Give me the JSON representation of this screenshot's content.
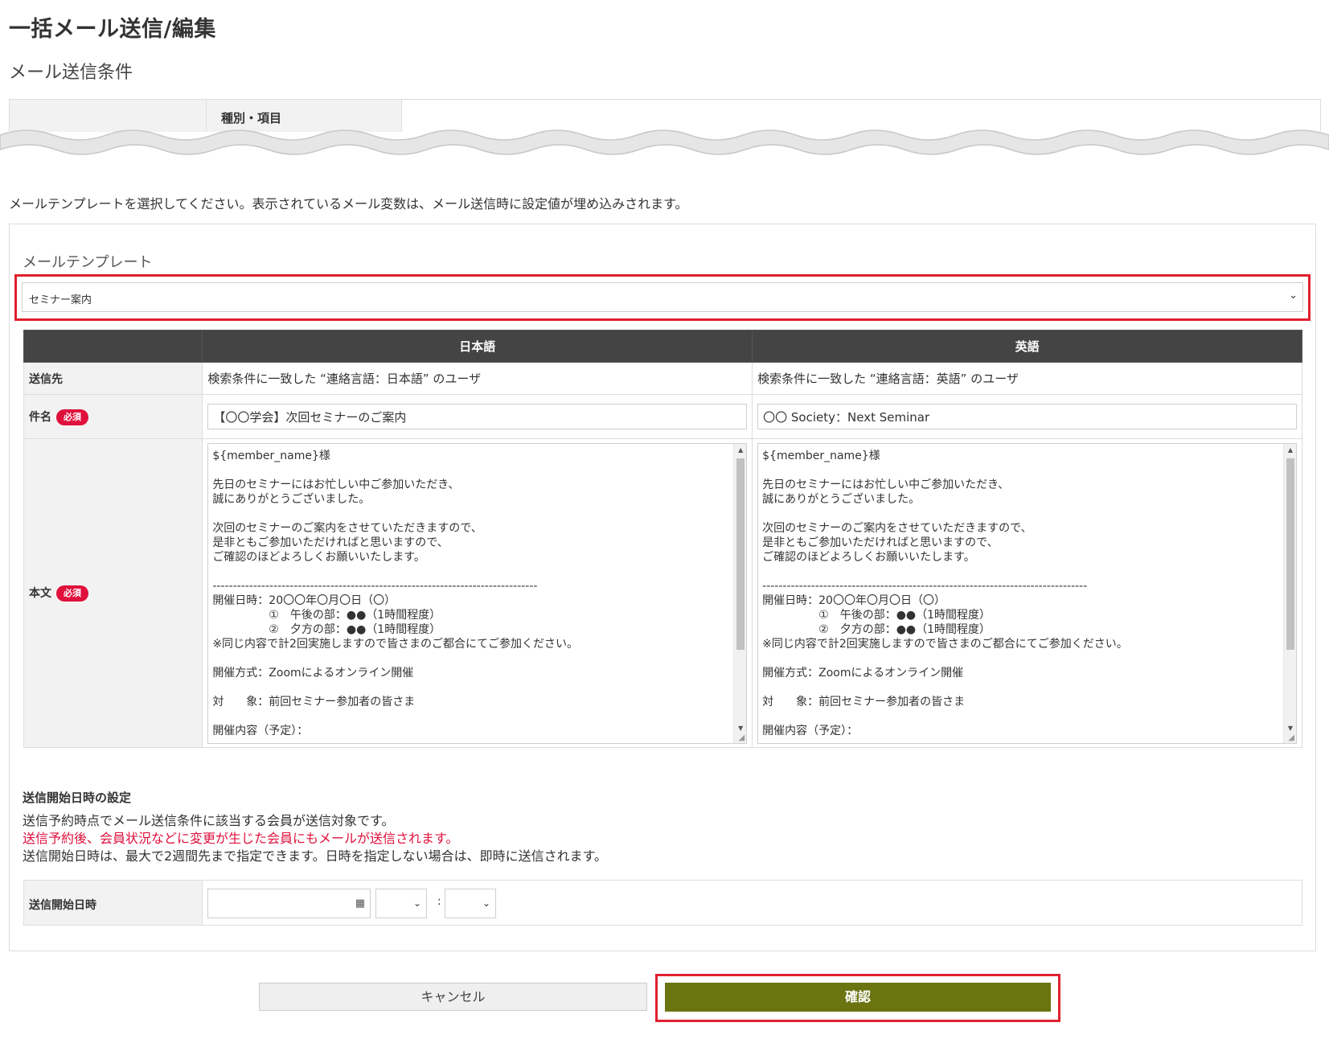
{
  "page": {
    "title": "一括メール送信/編集",
    "conditions_title": "メール送信条件",
    "conditions_header": "種別・項目",
    "instruction": "メールテンプレートを選択してください。表示されているメール変数は、メール送信時に設定値が埋め込みされます。"
  },
  "template": {
    "label": "メールテンプレート",
    "selected": "セミナー案内"
  },
  "table": {
    "col_ja": "日本語",
    "col_en": "英語",
    "row_recipient": "送信先",
    "row_subject": "件名",
    "row_body": "本文",
    "required_badge": "必須",
    "recipient_ja": "検索条件に一致した “連絡言語：日本語” のユーザ",
    "recipient_en": "検索条件に一致した “連絡言語：英語” のユーザ",
    "subject_ja": "【〇〇学会】次回セミナーのご案内",
    "subject_en": "〇〇 Society：Next Seminar",
    "body_ja": "${member_name}様\n\n先日のセミナーにはお忙しい中ご参加いただき、\n誠にありがとうございました。\n\n次回のセミナーのご案内をさせていただきますので、\n是非ともご参加いただければと思いますので、\nご確認のほどよろしくお願いいたします。\n\n--------------------------------------------------------------------------------\n開催日時：20〇〇年〇月〇日（〇）\n　　　　　①　午後の部：●●（1時間程度）\n　　　　　②　夕方の部：●●（1時間程度）\n※同じ内容で計2回実施しますので皆さまのご都合にてご参加ください。\n\n開催方式：Zoomによるオンライン開催\n\n対　　象：前回セミナー参加者の皆さま\n\n開催内容（予定）：",
    "body_en": "${member_name}様\n\n先日のセミナーにはお忙しい中ご参加いただき、\n誠にありがとうございました。\n\n次回のセミナーのご案内をさせていただきますので、\n是非ともご参加いただければと思いますので、\nご確認のほどよろしくお願いいたします。\n\n--------------------------------------------------------------------------------\n開催日時：20〇〇年〇月〇日（〇）\n　　　　　①　午後の部：●●（1時間程度）\n　　　　　②　夕方の部：●●（1時間程度）\n※同じ内容で計2回実施しますので皆さまのご都合にてご参加ください。\n\n開催方式：Zoomによるオンライン開催\n\n対　　象：前回セミナー参加者の皆さま\n\n開催内容（予定）："
  },
  "schedule": {
    "title": "送信開始日時の設定",
    "line1": "送信予約時点でメール送信条件に該当する会員が送信対象です。",
    "line2_warning": "送信予約後、会員状況などに変更が生じた会員にもメールが送信されます。",
    "line3": "送信開始日時は、最大で2週間先まで指定できます。日時を指定しない場合は、即時に送信されます。",
    "field_label": "送信開始日時",
    "date_value": "",
    "hour_value": "",
    "minute_value": "",
    "separator": ":"
  },
  "buttons": {
    "cancel": "キャンセル",
    "confirm": "確認"
  },
  "colors": {
    "accent_red": "#e0202e",
    "confirm_button": "#6b7410",
    "table_header": "#444444"
  }
}
